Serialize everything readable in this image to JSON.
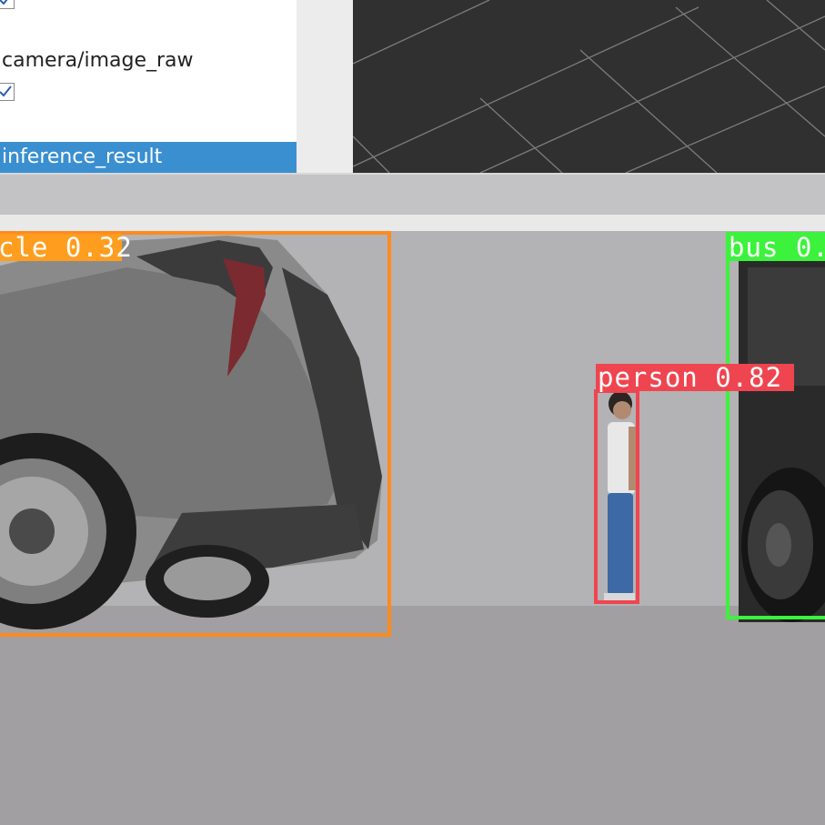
{
  "displays_panel": {
    "topic_label": "camera/image_raw",
    "selected_item": "inference_result"
  },
  "image_view": {
    "detections": [
      {
        "label": "cle 0.32",
        "color": "#ff8a1e"
      },
      {
        "label": "person 0.82",
        "color": "#ef4550"
      },
      {
        "label": "bus 0.",
        "color": "#3cf23c"
      }
    ]
  },
  "icons": [
    "checkbox-check-icon"
  ]
}
